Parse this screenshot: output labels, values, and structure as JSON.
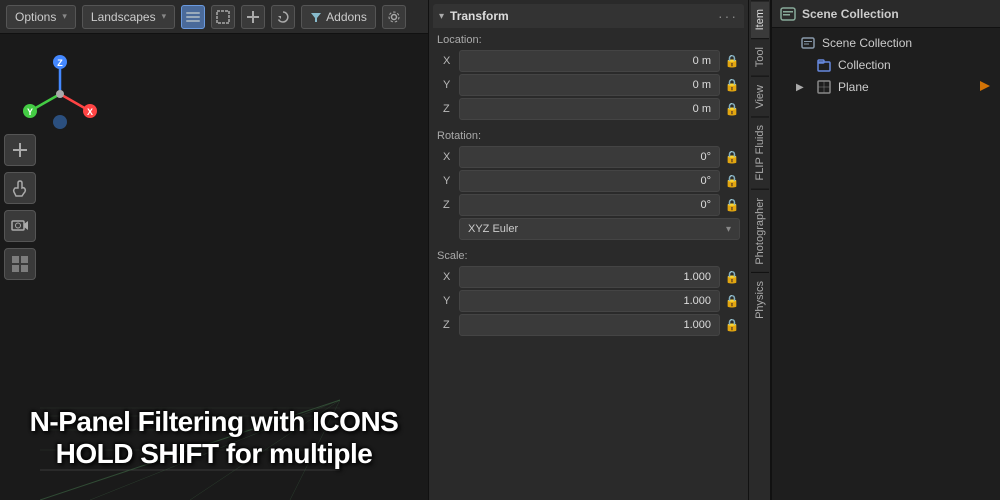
{
  "toolbar": {
    "options_label": "Options",
    "landscape_label": "Landscapes",
    "addons_label": "Addons",
    "chevron": "▾",
    "icons": {
      "list": "≡",
      "box_select": "⬚",
      "plus": "+",
      "circle_arrows": "↻",
      "funnel": "⊽",
      "gear": "⚙"
    }
  },
  "transform_panel": {
    "title": "Transform",
    "dots": "···",
    "location_label": "Location:",
    "location": {
      "x_value": "0 m",
      "y_value": "0 m",
      "z_value": "0 m"
    },
    "rotation_label": "Rotation:",
    "rotation": {
      "x_value": "0°",
      "y_value": "0°",
      "z_value": "0°"
    },
    "rotation_mode": "XYZ Euler",
    "scale_label": "Scale:",
    "scale": {
      "x_value": "1.000",
      "y_value": "1.000",
      "z_value": "1.000"
    },
    "x_label": "X",
    "y_label": "Y",
    "z_label": "Z"
  },
  "side_tabs": [
    {
      "label": "Item",
      "active": true
    },
    {
      "label": "Tool"
    },
    {
      "label": "View"
    },
    {
      "label": "FLIP Fluids"
    },
    {
      "label": "Photographer"
    },
    {
      "label": "Physics"
    }
  ],
  "outliner": {
    "title": "Scene Collection",
    "items": [
      {
        "label": "Scene Collection",
        "level": 0,
        "icon": "scene",
        "expand": "",
        "has_visibility": false
      },
      {
        "label": "Collection",
        "level": 1,
        "icon": "collection",
        "expand": "",
        "has_visibility": false
      },
      {
        "label": "Plane",
        "level": 1,
        "icon": "plane",
        "expand": "▶",
        "has_visibility": true
      }
    ]
  },
  "overlay": {
    "line1": "N-Panel Filtering with ICONS",
    "line2": "HOLD SHIFT for multiple"
  },
  "tools": [
    {
      "icon": "+",
      "name": "add-tool"
    },
    {
      "icon": "✋",
      "name": "grab-tool"
    },
    {
      "icon": "🎥",
      "name": "camera-tool"
    },
    {
      "icon": "▦",
      "name": "grid-tool"
    }
  ]
}
